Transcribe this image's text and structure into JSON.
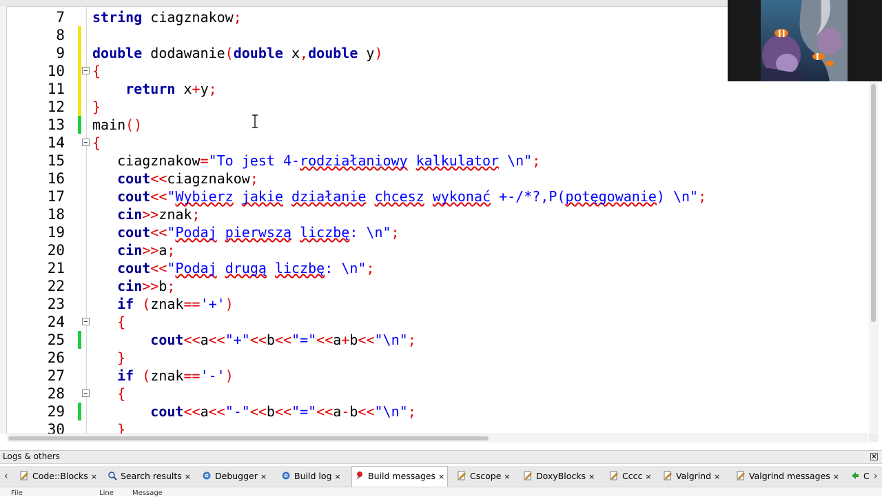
{
  "editor": {
    "lines": [
      {
        "num": "7",
        "mark": "",
        "fold": false,
        "segs": [
          {
            "t": "string",
            "c": "kw"
          },
          {
            "t": " ciagznakow"
          },
          {
            "t": ";",
            "c": "op"
          }
        ]
      },
      {
        "num": "8",
        "mark": "yellow",
        "fold": false,
        "segs": []
      },
      {
        "num": "9",
        "mark": "yellow",
        "fold": false,
        "segs": [
          {
            "t": "double",
            "c": "kw"
          },
          {
            "t": " dodawanie"
          },
          {
            "t": "(",
            "c": "op"
          },
          {
            "t": "double",
            "c": "kw"
          },
          {
            "t": " x"
          },
          {
            "t": ",",
            "c": "op"
          },
          {
            "t": "double",
            "c": "kw"
          },
          {
            "t": " y"
          },
          {
            "t": ")",
            "c": "op"
          }
        ]
      },
      {
        "num": "10",
        "mark": "yellow",
        "fold": true,
        "segs": [
          {
            "t": "{",
            "c": "op"
          }
        ]
      },
      {
        "num": "11",
        "mark": "yellow",
        "fold": false,
        "segs": [
          {
            "t": "    "
          },
          {
            "t": "return",
            "c": "kw"
          },
          {
            "t": " x"
          },
          {
            "t": "+",
            "c": "op"
          },
          {
            "t": "y"
          },
          {
            "t": ";",
            "c": "op"
          }
        ]
      },
      {
        "num": "12",
        "mark": "yellow",
        "fold": false,
        "segs": [
          {
            "t": "}",
            "c": "op"
          }
        ]
      },
      {
        "num": "13",
        "mark": "green",
        "fold": false,
        "segs": [
          {
            "t": "main"
          },
          {
            "t": "()",
            "c": "op"
          }
        ]
      },
      {
        "num": "14",
        "mark": "",
        "fold": true,
        "segs": [
          {
            "t": "{",
            "c": "op"
          }
        ]
      },
      {
        "num": "15",
        "mark": "",
        "fold": false,
        "segs": [
          {
            "t": "   ciagznakow"
          },
          {
            "t": "=",
            "c": "op"
          },
          {
            "t": "\"To jest 4-",
            "c": "str"
          },
          {
            "t": "rodziałaniowy",
            "c": "str sq"
          },
          {
            "t": " ",
            "c": "str"
          },
          {
            "t": "kalkulator",
            "c": "str sq"
          },
          {
            "t": " \\n\"",
            "c": "str"
          },
          {
            "t": ";",
            "c": "op"
          }
        ]
      },
      {
        "num": "16",
        "mark": "",
        "fold": false,
        "segs": [
          {
            "t": "   "
          },
          {
            "t": "cout",
            "c": "kw2"
          },
          {
            "t": "<<",
            "c": "op"
          },
          {
            "t": "ciagznakow"
          },
          {
            "t": ";",
            "c": "op"
          }
        ]
      },
      {
        "num": "17",
        "mark": "",
        "fold": false,
        "segs": [
          {
            "t": "   "
          },
          {
            "t": "cout",
            "c": "kw2"
          },
          {
            "t": "<<",
            "c": "op"
          },
          {
            "t": "\"",
            "c": "str"
          },
          {
            "t": "Wybierz",
            "c": "str sq"
          },
          {
            "t": " ",
            "c": "str"
          },
          {
            "t": "jakie",
            "c": "str sq"
          },
          {
            "t": " ",
            "c": "str"
          },
          {
            "t": "działanie",
            "c": "str sq"
          },
          {
            "t": " ",
            "c": "str"
          },
          {
            "t": "chcesz",
            "c": "str sq"
          },
          {
            "t": " ",
            "c": "str"
          },
          {
            "t": "wykonać",
            "c": "str sq"
          },
          {
            "t": " +-/*?,P(",
            "c": "str"
          },
          {
            "t": "potęgowanie",
            "c": "str sq"
          },
          {
            "t": ") \\n\"",
            "c": "str"
          },
          {
            "t": ";",
            "c": "op"
          }
        ]
      },
      {
        "num": "18",
        "mark": "",
        "fold": false,
        "segs": [
          {
            "t": "   "
          },
          {
            "t": "cin",
            "c": "kw2"
          },
          {
            "t": ">>",
            "c": "op"
          },
          {
            "t": "znak"
          },
          {
            "t": ";",
            "c": "op"
          }
        ]
      },
      {
        "num": "19",
        "mark": "",
        "fold": false,
        "segs": [
          {
            "t": "   "
          },
          {
            "t": "cout",
            "c": "kw2"
          },
          {
            "t": "<<",
            "c": "op"
          },
          {
            "t": "\"",
            "c": "str"
          },
          {
            "t": "Podaj",
            "c": "str sq"
          },
          {
            "t": " ",
            "c": "str"
          },
          {
            "t": "pierwszą",
            "c": "str sq"
          },
          {
            "t": " ",
            "c": "str"
          },
          {
            "t": "liczbę",
            "c": "str sq"
          },
          {
            "t": ": \\n\"",
            "c": "str"
          },
          {
            "t": ";",
            "c": "op"
          }
        ]
      },
      {
        "num": "20",
        "mark": "",
        "fold": false,
        "segs": [
          {
            "t": "   "
          },
          {
            "t": "cin",
            "c": "kw2"
          },
          {
            "t": ">>",
            "c": "op"
          },
          {
            "t": "a"
          },
          {
            "t": ";",
            "c": "op"
          }
        ]
      },
      {
        "num": "21",
        "mark": "",
        "fold": false,
        "segs": [
          {
            "t": "   "
          },
          {
            "t": "cout",
            "c": "kw2"
          },
          {
            "t": "<<",
            "c": "op"
          },
          {
            "t": "\"",
            "c": "str"
          },
          {
            "t": "Podaj",
            "c": "str sq"
          },
          {
            "t": " ",
            "c": "str"
          },
          {
            "t": "drugą",
            "c": "str sq"
          },
          {
            "t": " ",
            "c": "str"
          },
          {
            "t": "liczbę",
            "c": "str sq"
          },
          {
            "t": ": \\n\"",
            "c": "str"
          },
          {
            "t": ";",
            "c": "op"
          }
        ]
      },
      {
        "num": "22",
        "mark": "",
        "fold": false,
        "segs": [
          {
            "t": "   "
          },
          {
            "t": "cin",
            "c": "kw2"
          },
          {
            "t": ">>",
            "c": "op"
          },
          {
            "t": "b"
          },
          {
            "t": ";",
            "c": "op"
          }
        ]
      },
      {
        "num": "23",
        "mark": "",
        "fold": false,
        "segs": [
          {
            "t": "   "
          },
          {
            "t": "if",
            "c": "kw"
          },
          {
            "t": " "
          },
          {
            "t": "(",
            "c": "op"
          },
          {
            "t": "znak"
          },
          {
            "t": "==",
            "c": "op"
          },
          {
            "t": "'+'",
            "c": "str"
          },
          {
            "t": ")",
            "c": "op"
          }
        ]
      },
      {
        "num": "24",
        "mark": "",
        "fold": true,
        "segs": [
          {
            "t": "   "
          },
          {
            "t": "{",
            "c": "op"
          }
        ]
      },
      {
        "num": "25",
        "mark": "green",
        "fold": false,
        "segs": [
          {
            "t": "       "
          },
          {
            "t": "cout",
            "c": "kw2"
          },
          {
            "t": "<<",
            "c": "op"
          },
          {
            "t": "a"
          },
          {
            "t": "<<",
            "c": "op"
          },
          {
            "t": "\"+\"",
            "c": "str"
          },
          {
            "t": "<<",
            "c": "op"
          },
          {
            "t": "b"
          },
          {
            "t": "<<",
            "c": "op"
          },
          {
            "t": "\"=\"",
            "c": "str"
          },
          {
            "t": "<<",
            "c": "op"
          },
          {
            "t": "a"
          },
          {
            "t": "+",
            "c": "op"
          },
          {
            "t": "b"
          },
          {
            "t": "<<",
            "c": "op"
          },
          {
            "t": "\"\\n\"",
            "c": "str"
          },
          {
            "t": ";",
            "c": "op"
          }
        ]
      },
      {
        "num": "26",
        "mark": "",
        "fold": false,
        "segs": [
          {
            "t": "   "
          },
          {
            "t": "}",
            "c": "op"
          }
        ]
      },
      {
        "num": "27",
        "mark": "",
        "fold": false,
        "segs": [
          {
            "t": "   "
          },
          {
            "t": "if",
            "c": "kw"
          },
          {
            "t": " "
          },
          {
            "t": "(",
            "c": "op"
          },
          {
            "t": "znak"
          },
          {
            "t": "==",
            "c": "op"
          },
          {
            "t": "'-'",
            "c": "str"
          },
          {
            "t": ")",
            "c": "op"
          }
        ]
      },
      {
        "num": "28",
        "mark": "",
        "fold": true,
        "segs": [
          {
            "t": "   "
          },
          {
            "t": "{",
            "c": "op"
          }
        ]
      },
      {
        "num": "29",
        "mark": "green",
        "fold": false,
        "segs": [
          {
            "t": "       "
          },
          {
            "t": "cout",
            "c": "kw2"
          },
          {
            "t": "<<",
            "c": "op"
          },
          {
            "t": "a"
          },
          {
            "t": "<<",
            "c": "op"
          },
          {
            "t": "\"-\"",
            "c": "str"
          },
          {
            "t": "<<",
            "c": "op"
          },
          {
            "t": "b"
          },
          {
            "t": "<<",
            "c": "op"
          },
          {
            "t": "\"=\"",
            "c": "str"
          },
          {
            "t": "<<",
            "c": "op"
          },
          {
            "t": "a"
          },
          {
            "t": "-",
            "c": "op"
          },
          {
            "t": "b"
          },
          {
            "t": "<<",
            "c": "op"
          },
          {
            "t": "\"\\n\"",
            "c": "str"
          },
          {
            "t": ";",
            "c": "op"
          }
        ]
      },
      {
        "num": "30",
        "mark": "",
        "fold": false,
        "segs": [
          {
            "t": "   "
          },
          {
            "t": "}",
            "c": "op"
          }
        ]
      }
    ]
  },
  "logs": {
    "title": "Logs & others",
    "close_label": "×",
    "tabs": [
      {
        "label": "Code::Blocks",
        "icon": "document-edit-icon",
        "active": false
      },
      {
        "label": "Search results",
        "icon": "magnifier-icon",
        "active": false
      },
      {
        "label": "Debugger",
        "icon": "gear-icon",
        "active": false
      },
      {
        "label": "Build log",
        "icon": "gear-icon",
        "active": false
      },
      {
        "label": "Build messages",
        "icon": "red-pin-icon",
        "active": true
      },
      {
        "label": "Cscope",
        "icon": "document-edit-icon",
        "active": false
      },
      {
        "label": "DoxyBlocks",
        "icon": "document-edit-icon",
        "active": false
      },
      {
        "label": "Cccc",
        "icon": "document-edit-icon",
        "active": false
      },
      {
        "label": "Valgrind",
        "icon": "document-edit-icon",
        "active": false
      },
      {
        "label": "Valgrind messages",
        "icon": "document-edit-icon",
        "active": false
      },
      {
        "label": "C",
        "icon": "green-arrow-icon",
        "active": false
      }
    ],
    "tab_close": "×",
    "left_arrow": "‹",
    "right_arrow": "›",
    "columns": [
      "File",
      "Line",
      "Message"
    ]
  }
}
